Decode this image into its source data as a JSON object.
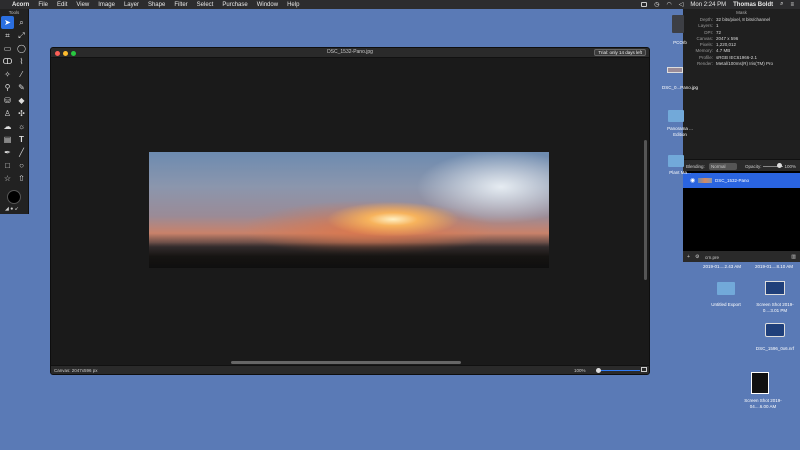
{
  "menubar": {
    "app": "Acorn",
    "items": [
      "File",
      "Edit",
      "View",
      "Image",
      "Layer",
      "Shape",
      "Filter",
      "Select",
      "Purchase",
      "Window",
      "Help"
    ],
    "clock": "Mon 2:24 PM",
    "user": "Thomas Boldt"
  },
  "tools": {
    "title": "Tools"
  },
  "window": {
    "title": "DSC_1532-Pano.jpg",
    "trial": "Trial: only 14 days left",
    "canvas_size": "Canvas: 2047x596 px",
    "zoom": "100%"
  },
  "info": {
    "header": "Mask",
    "rows": [
      {
        "k": "Depth:",
        "v": "32 bits/pixel, 8 bits/channel"
      },
      {
        "k": "Layers:",
        "v": "1"
      },
      {
        "k": "DPI:",
        "v": "72"
      },
      {
        "k": "Canvas:",
        "v": "2047 x 596"
      },
      {
        "k": "Pixels:",
        "v": "1,220,012"
      },
      {
        "k": "Memory:",
        "v": "4.7 MB"
      },
      {
        "k": "Profile:",
        "v": "sRGB IEC61966-2.1"
      },
      {
        "k": "Render:",
        "v": "Metal/100ms(R) Iris(TM) Pro"
      }
    ]
  },
  "blending": {
    "label": "Blending:",
    "mode": "Normal",
    "opacity_label": "Opacity:",
    "opacity": "100%"
  },
  "layers": [
    {
      "name": "DSC_1532-Pano"
    }
  ],
  "layer_bar": {
    "add": "+",
    "remove_icon": "trash-icon",
    "name_field": "crn.pre"
  },
  "desktop": {
    "icons": [
      {
        "label": "PCOrb"
      },
      {
        "label": "DSC_0...Pano.jpg"
      },
      {
        "label": "Panorama ... Edition"
      },
      {
        "label": "Plant Ma..."
      },
      {
        "label": "2019-01....2.43 AM"
      },
      {
        "label": "2019-01....8.10 AM"
      },
      {
        "label": "Untitled Export"
      },
      {
        "label": "Screen Shot 2019-0....3.01 PM"
      },
      {
        "label": "DSC_1596_0x6.nrf"
      },
      {
        "label": "Screen Shot 2019-04....6.00 AM"
      }
    ]
  }
}
